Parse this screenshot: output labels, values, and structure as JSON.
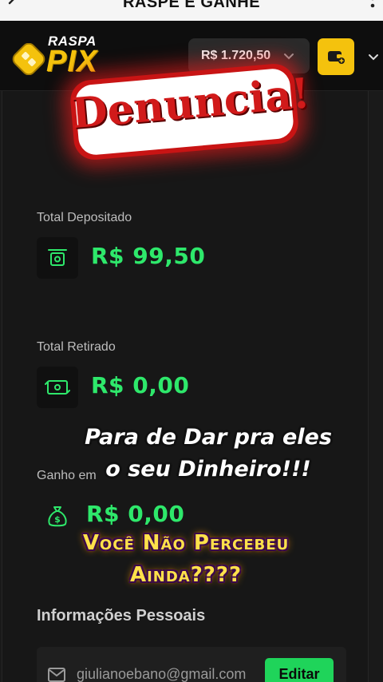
{
  "topbar": {
    "title": "RASPE E GANHE"
  },
  "header": {
    "logo": {
      "raspa": "RASPA",
      "pix": "PIX"
    },
    "balance": "R$ 1.720,50"
  },
  "stats": {
    "deposited": {
      "label": "Total Depositado",
      "value": "R$ 99,50"
    },
    "withdrawn": {
      "label": "Total Retirado",
      "value": "R$ 0,00"
    },
    "won": {
      "label": "Ganho em",
      "value": "R$ 0,00"
    }
  },
  "personal": {
    "title": "Informações Pessoais",
    "email": "giulianoebano@gmail.com",
    "edit_label": "Editar"
  },
  "overlay": {
    "denuncia": "Denuncia!",
    "caption1_line1": "Para de Dar pra eles",
    "caption1_line2": "o seu Dinheiro!!!",
    "caption2_line1": "Você Não Percebeu",
    "caption2_line2": "Ainda????"
  },
  "colors": {
    "accent_yellow": "#f4c20d",
    "money_green": "#2ee86b",
    "edit_green": "#1fd45a",
    "sticker_red": "#d11a1a"
  }
}
